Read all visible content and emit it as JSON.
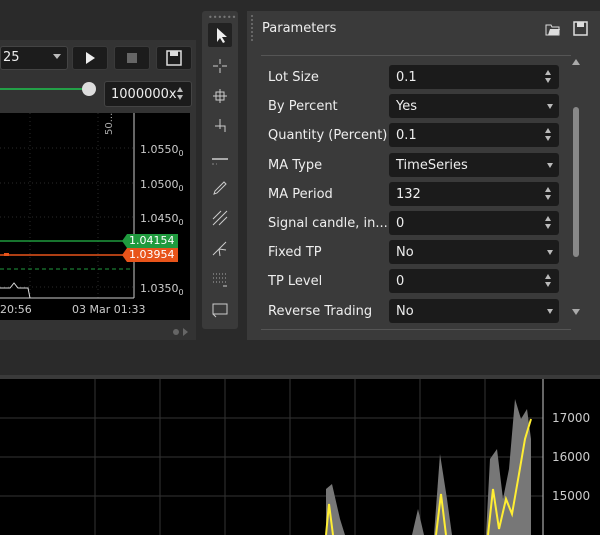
{
  "toolbar": {
    "speed_value": "25",
    "multiplier": "1000000x"
  },
  "chart_top": {
    "y_ticks": [
      {
        "value": "1.0550",
        "sub": "0"
      },
      {
        "value": "1.0500",
        "sub": "0"
      },
      {
        "value": "1.0450",
        "sub": "0"
      },
      {
        "value": "1.0350",
        "sub": "0"
      }
    ],
    "price_green": "1.04154",
    "price_orange": "1.03954",
    "x_ticks": [
      "20:56",
      "03 Mar 01:33"
    ],
    "scale_label": "50..."
  },
  "params": {
    "title": "Parameters",
    "rows": [
      {
        "label": "Lot Size",
        "value": "0.1",
        "control": "spin"
      },
      {
        "label": "By Percent",
        "value": "Yes",
        "control": "drop"
      },
      {
        "label": "Quantity (Percent)",
        "value": "0.1",
        "control": "spin"
      },
      {
        "label": "MA Type",
        "value": "TimeSeries",
        "control": "drop"
      },
      {
        "label": "MA Period",
        "value": "132",
        "control": "spin"
      },
      {
        "label": "Signal candle, in...",
        "value": "0",
        "control": "spin"
      },
      {
        "label": "Fixed TP",
        "value": "No",
        "control": "drop"
      },
      {
        "label": "TP Level",
        "value": "0",
        "control": "spin"
      },
      {
        "label": "Reverse Trading",
        "value": "No",
        "control": "drop"
      }
    ]
  },
  "chart_bottom": {
    "y_ticks": [
      "17000",
      "16000",
      "15000"
    ]
  },
  "colors": {
    "green": "#1f9a3e",
    "orange": "#e8541a",
    "yellow": "#ffee33",
    "panel": "#3a3a3a"
  }
}
